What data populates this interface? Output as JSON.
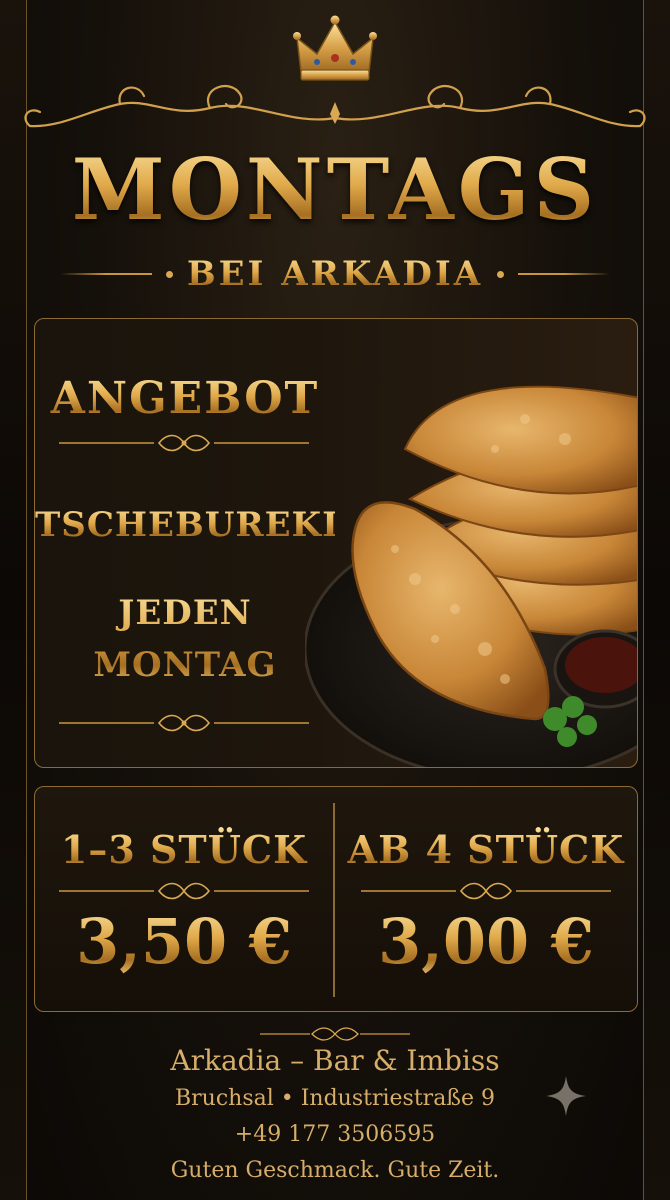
{
  "header": {
    "title": "MONTAGS",
    "subtitle": "BEI ARKADIA"
  },
  "offer": {
    "heading": "ANGEBOT",
    "item": "TSCHEBUREKI",
    "schedule_line1": "JEDEN",
    "schedule_line2": "MONTAG"
  },
  "prices": [
    {
      "label": "1–3 STÜCK",
      "value": "3,50 €"
    },
    {
      "label": "AB 4 STÜCK",
      "value": "3,00 €"
    }
  ],
  "footer": {
    "name": "Arkadia – Bar & Imbiss",
    "address": "Bruchsal • Industriestraße 9",
    "phone": "+49 177 3506595",
    "slogan": "Guten Geschmack. Gute Zeit."
  },
  "icons": {
    "crown": "crown-icon",
    "ornament": "ornament-flourish-icon",
    "sparkle": "sparkle-icon"
  },
  "colors": {
    "gold": "#e0a94a",
    "background": "#15100a",
    "border": "#8c6a34"
  }
}
